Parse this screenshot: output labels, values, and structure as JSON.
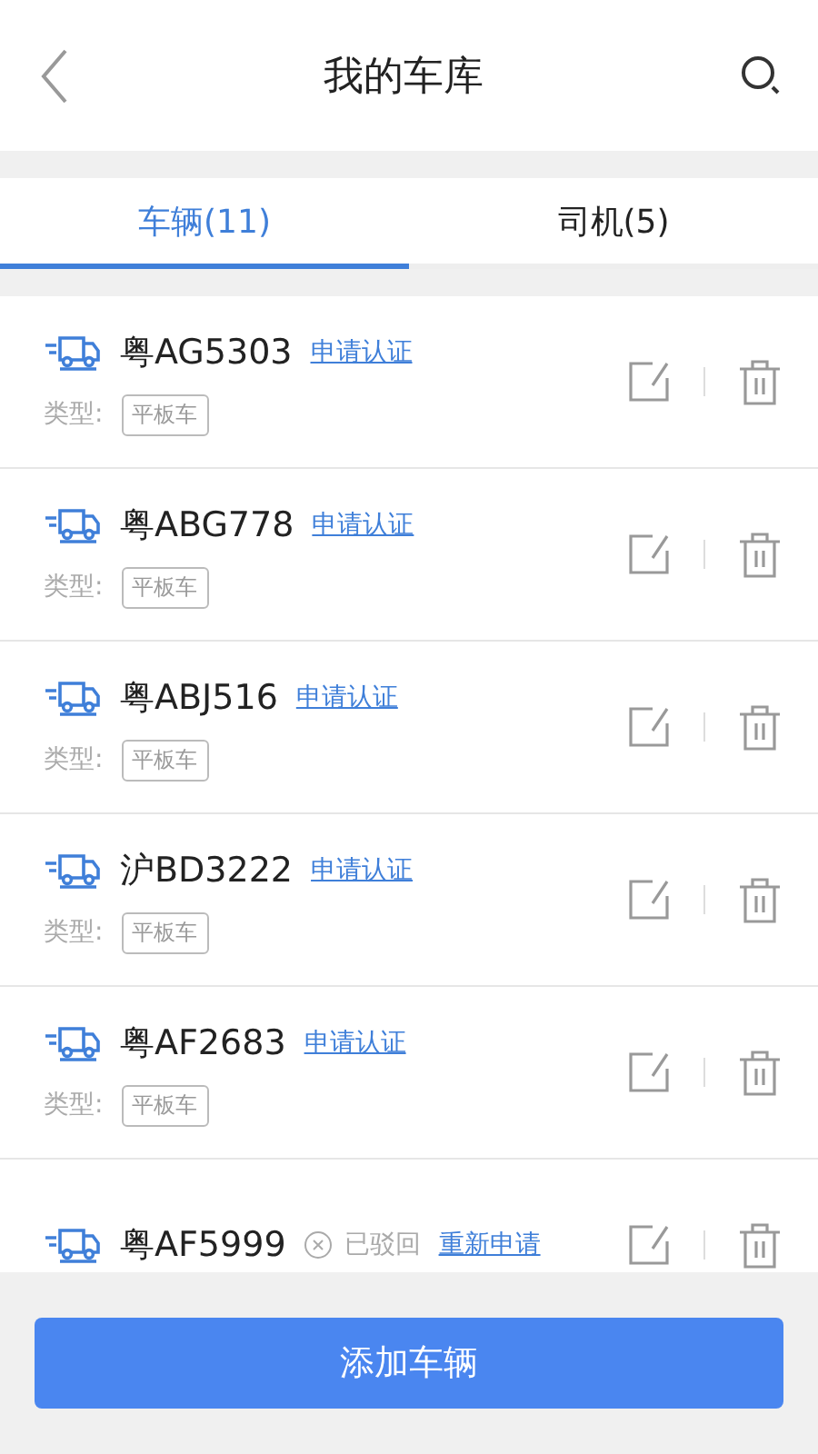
{
  "header": {
    "title": "我的车库"
  },
  "tabs": [
    {
      "label": "车辆(11)",
      "selected": true
    },
    {
      "label": "司机(5)",
      "selected": false
    }
  ],
  "vehicles": [
    {
      "plate": "粤AG5303",
      "kind": "pending",
      "action": "申请认证",
      "type_label": "类型:",
      "type": "平板车"
    },
    {
      "plate": "粤ABG778",
      "kind": "pending",
      "action": "申请认证",
      "type_label": "类型:",
      "type": "平板车"
    },
    {
      "plate": "粤ABJ516",
      "kind": "pending",
      "action": "申请认证",
      "type_label": "类型:",
      "type": "平板车"
    },
    {
      "plate": "沪BD3222",
      "kind": "pending",
      "action": "申请认证",
      "type_label": "类型:",
      "type": "平板车"
    },
    {
      "plate": "粤AF2683",
      "kind": "pending",
      "action": "申请认证",
      "type_label": "类型:",
      "type": "平板车"
    },
    {
      "plate": "粤AF5999",
      "kind": "rejected",
      "status": "已驳回",
      "action": "重新申请"
    }
  ],
  "add_button": "添加车辆"
}
